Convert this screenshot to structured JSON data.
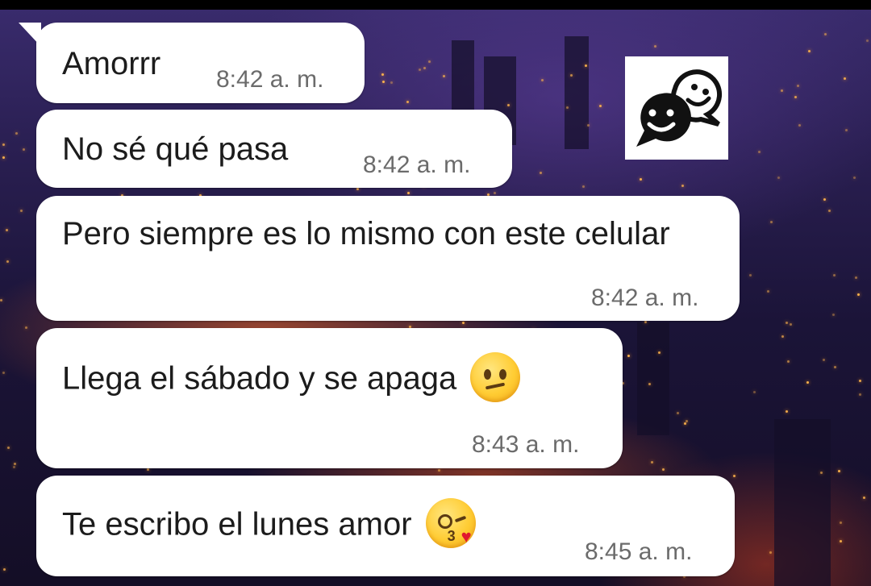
{
  "messages": [
    {
      "text": "Amorrr",
      "time": "8:42 a. m."
    },
    {
      "text": "No sé qué pasa",
      "time": "8:42 a. m."
    },
    {
      "text": "Pero siempre es lo mismo con este celular",
      "time": "8:42 a. m."
    },
    {
      "text": "Llega el sábado y se apaga",
      "time": "8:43 a. m.",
      "emoji": "confused-face-emoji"
    },
    {
      "text": "Te escribo el lunes amor",
      "time": "8:45 a. m.",
      "emoji": "face-blowing-kiss-emoji"
    }
  ],
  "watermark": {
    "icon": "chat-faces-logo-icon"
  },
  "colors": {
    "bubble": "#ffffff",
    "text": "#1c1c1c",
    "timestamp": "#6b6b6b",
    "wallpaper_base": "#1b1438"
  }
}
